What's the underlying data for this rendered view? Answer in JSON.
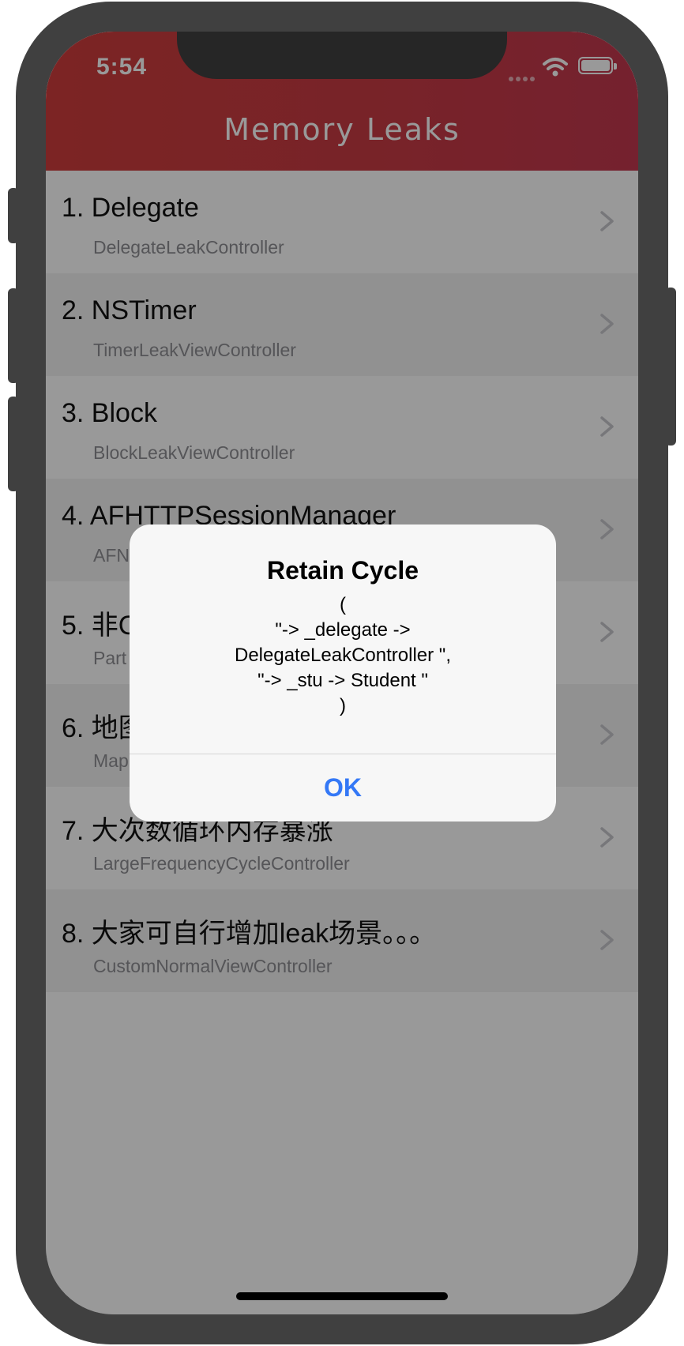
{
  "status_bar": {
    "time": "5:54"
  },
  "navbar": {
    "title": "Memory Leaks"
  },
  "list": {
    "items": [
      {
        "title": "1. Delegate",
        "subtitle": "DelegateLeakController"
      },
      {
        "title": "2. NSTimer",
        "subtitle": "TimerLeakViewController"
      },
      {
        "title": "3. Block",
        "subtitle": "BlockLeakViewController"
      },
      {
        "title": "4. AFHTTPSessionManager",
        "subtitle": "AFN"
      },
      {
        "title": "5. 非C",
        "subtitle": "Part"
      },
      {
        "title": "6. 地图",
        "subtitle": "Map"
      },
      {
        "title": "7. 大次数循环内存暴涨",
        "subtitle": "LargeFrequencyCycleController"
      },
      {
        "title": "8. 大家可自行增加leak场景。。。",
        "subtitle": "CustomNormalViewController"
      }
    ]
  },
  "alert": {
    "title": "Retain Cycle",
    "message": "(\n\"-> _delegate ->\nDelegateLeakController \",\n\"-> _stu -> Student \"\n)",
    "ok_label": "OK"
  },
  "colors": {
    "navbar_red": "#cf3c3c",
    "alert_button_blue": "#3478f6",
    "frame": "#404040"
  },
  "icons": {
    "row_accessory": "chevron-right-icon",
    "wifi": "wifi-icon",
    "battery": "battery-icon"
  }
}
